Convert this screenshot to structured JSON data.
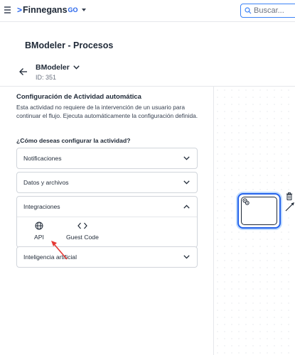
{
  "topbar": {
    "brand": "Finnegans",
    "brand_suffix": "GO",
    "search_placeholder": "Buscar..."
  },
  "page": {
    "title": "BModeler - Procesos"
  },
  "process": {
    "name": "BModeler",
    "id_label": "ID: 351"
  },
  "config": {
    "title": "Configuración de Actividad automática",
    "description": "Esta actividad no requiere de la intervención de un usuario para continuar el flujo. Ejecuta automáticamente la configuración definida.",
    "question": "¿Cómo deseas configurar la actividad?"
  },
  "accordions": [
    {
      "label": "Notificaciones",
      "expanded": false
    },
    {
      "label": "Datos y archivos",
      "expanded": false
    },
    {
      "label": "Integraciones",
      "expanded": true,
      "options": [
        {
          "label": "API",
          "icon": "globe-icon"
        },
        {
          "label": "Guest Code",
          "icon": "code-icon"
        }
      ]
    },
    {
      "label": "Inteligencia artificial",
      "expanded": false
    }
  ],
  "colors": {
    "accent": "#2563eb",
    "annotation": "#e53935"
  }
}
